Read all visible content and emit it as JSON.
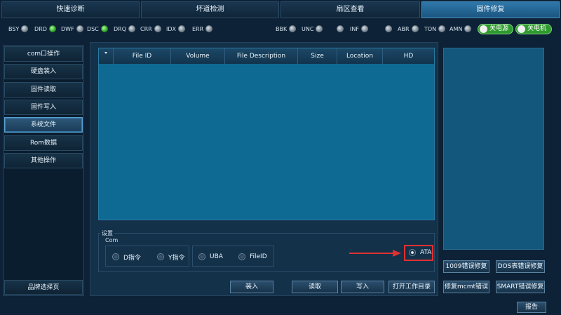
{
  "tabs": [
    {
      "label": "快速诊断"
    },
    {
      "label": "坏道检测"
    },
    {
      "label": "扇区查看"
    },
    {
      "label": "固件修复"
    }
  ],
  "indicators": {
    "left": [
      {
        "label": "BSY",
        "state": "off"
      },
      {
        "label": "DRD",
        "state": "on"
      },
      {
        "label": "DWF",
        "state": "off"
      },
      {
        "label": "DSC",
        "state": "on"
      },
      {
        "label": "DRQ",
        "state": "off"
      },
      {
        "label": "CRR",
        "state": "off"
      },
      {
        "label": "IDX",
        "state": "off"
      },
      {
        "label": "ERR",
        "state": "off"
      }
    ],
    "right": [
      {
        "label": "BBK",
        "state": "off"
      },
      {
        "label": "UNC",
        "state": "off"
      },
      {
        "label": "",
        "state": "off"
      },
      {
        "label": "INF",
        "state": "off"
      },
      {
        "label": "",
        "state": "off"
      },
      {
        "label": "ABR",
        "state": "off"
      },
      {
        "label": "TON",
        "state": "off"
      },
      {
        "label": "AMN",
        "state": "off"
      }
    ],
    "on_color": "#34b430",
    "off_color": "#7a8690"
  },
  "toggles": {
    "power_off": "关电源",
    "motor_off": "关电机"
  },
  "sidebar": {
    "items": [
      {
        "label": "com口操作"
      },
      {
        "label": "硬盘装入"
      },
      {
        "label": "固件读取"
      },
      {
        "label": "固件写入"
      },
      {
        "label": "系统文件"
      },
      {
        "label": "Rom数据"
      },
      {
        "label": "其他操作"
      }
    ],
    "active_index": 4,
    "brand_select": "品牌选择页"
  },
  "table": {
    "columns": [
      "File ID",
      "Volume",
      "File Description",
      "Size",
      "Location",
      "HD"
    ],
    "rows": []
  },
  "settings": {
    "legend": "设置",
    "com_legend": "Com",
    "options": [
      "D指令",
      "Y指令",
      "UBA",
      "FileID",
      "ATA"
    ],
    "selected": "ATA"
  },
  "buttons": {
    "load": "装入",
    "read": "读取",
    "write": "写入",
    "open_dir": "打开工作目录",
    "fix_mcmt": "修复mcmt错误",
    "fix_1009": "1009错误修复",
    "fix_dos": "DOS表错误修复",
    "fix_smart": "SMART错误修复",
    "report": "报告"
  },
  "colors": {
    "accent": "#1b5680",
    "highlight": "#e03030",
    "arrow": "#e03030"
  }
}
